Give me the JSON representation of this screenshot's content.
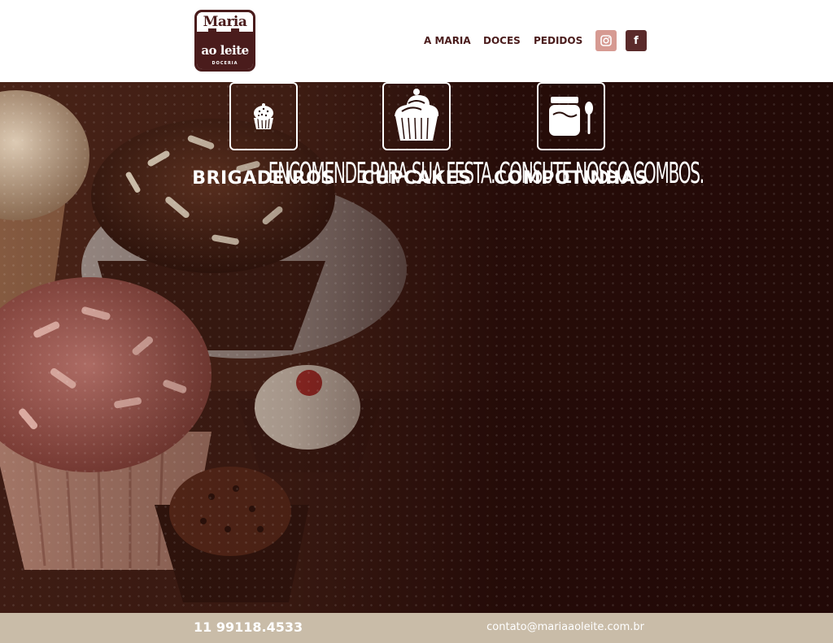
{
  "brand": {
    "logo_line1": "Maria",
    "logo_line2": "ao leite",
    "logo_line3": "DOCERIA",
    "colors": {
      "primary": "#4a1c1c",
      "accent": "#d69a92",
      "footer": "#c9bca8"
    }
  },
  "nav": {
    "items": [
      {
        "label": "A MARIA"
      },
      {
        "label": "DOCES"
      },
      {
        "label": "PEDIDOS"
      }
    ],
    "social": [
      {
        "name": "instagram",
        "icon": "instagram-icon"
      },
      {
        "name": "facebook",
        "icon": "facebook-icon",
        "glyph": "f"
      }
    ]
  },
  "hero": {
    "headline": "ENCOMENDE PARA SUA FESTA. CONSUTE NOSSO COMBOS.",
    "categories": [
      {
        "label": "BRIGADEIROS",
        "icon": "brigadeiro-icon"
      },
      {
        "label": "CUPCAKES",
        "icon": "cupcake-icon"
      },
      {
        "label": "COMPOTINHAS",
        "icon": "jar-spoon-icon"
      }
    ]
  },
  "footer": {
    "phone": "11 99118.4533",
    "email": "contato@mariaaoleite.com.br"
  }
}
